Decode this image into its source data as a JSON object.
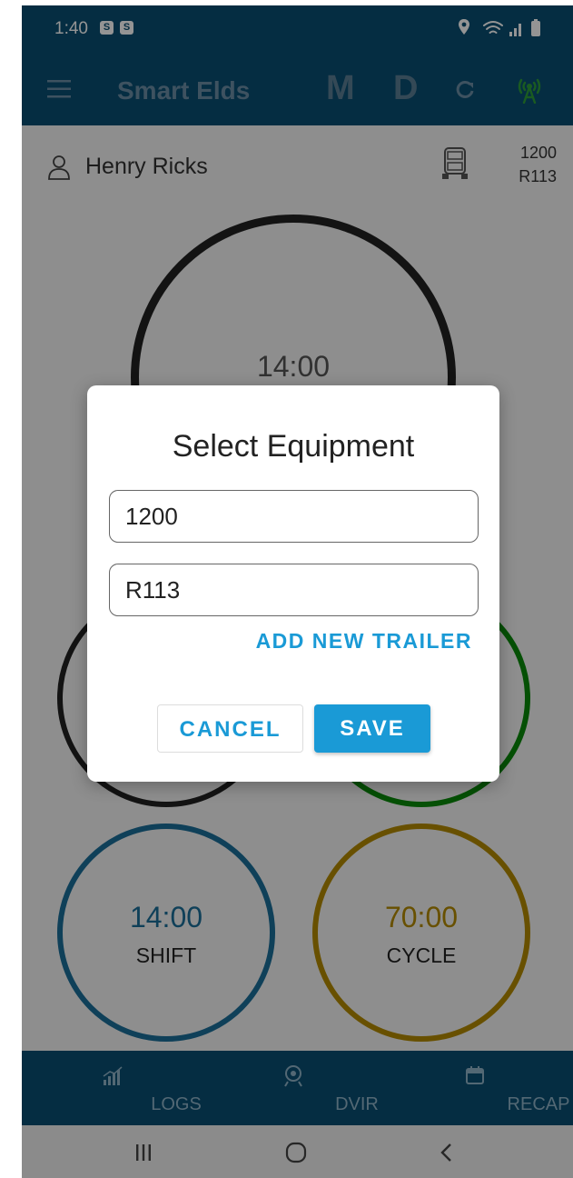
{
  "status_bar": {
    "time": "1:40",
    "badge": "S",
    "icons": [
      "location-icon",
      "wifi-icon",
      "signal-icon",
      "battery-icon"
    ]
  },
  "app_bar": {
    "title": "Smart Elds",
    "mode_m": "M",
    "mode_d": "D",
    "icons": [
      "menu-icon",
      "refresh-icon",
      "antenna-icon"
    ],
    "antenna_color": "#2e9e3a"
  },
  "driver": {
    "name": "Henry Ricks",
    "truck": "1200",
    "trailer": "R113"
  },
  "rings": {
    "top": {
      "value": "14:00",
      "color": "#222222"
    },
    "shift": {
      "value": "14:00",
      "label": "SHIFT",
      "color": "#1a6e99"
    },
    "cycle": {
      "value": "70:00",
      "label": "CYCLE",
      "color": "#b48b00"
    },
    "left_color": "#222222",
    "right_color": "#0a8a0a"
  },
  "dialog": {
    "title": "Select Equipment",
    "truck_value": "1200",
    "trailer_value": "R113",
    "add_trailer": "ADD NEW TRAILER",
    "cancel": "CANCEL",
    "save": "SAVE"
  },
  "bottom_nav": {
    "logs": "LOGS",
    "dvir": "DVIR",
    "recap": "RECAP"
  },
  "colors": {
    "primary": "#0a4f73",
    "accent": "#1a9ad6"
  }
}
